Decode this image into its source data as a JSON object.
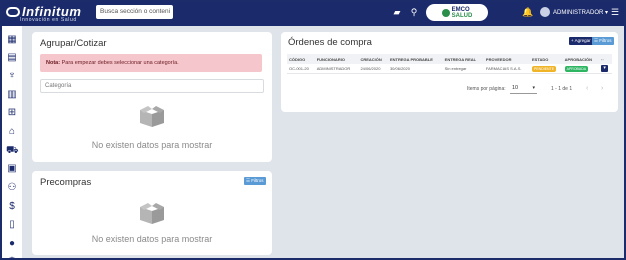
{
  "header": {
    "logo_text": "Infinitum",
    "logo_tagline": "Innovación en Salud",
    "search_placeholder": "Busca sección o conteni",
    "partner_line1": "EMCO",
    "partner_line2": "SALUD",
    "user_label": "ADMINISTRADOR ▾"
  },
  "sidebar": {
    "icons": [
      "dashboard-icon",
      "calendar-icon",
      "stethoscope-icon",
      "hospital-icon",
      "medkit-icon",
      "store-icon",
      "cart-icon",
      "archive-icon",
      "user-search-icon",
      "dollar-icon",
      "book-icon",
      "user-icon",
      "gear-icon"
    ]
  },
  "agrupar": {
    "title": "Agrupar/Cotizar",
    "note_bold": "Nota:",
    "note_text": " Para empezar debes seleccionar una categoría.",
    "category_placeholder": "Categoría",
    "empty_text": "No existen datos para mostrar"
  },
  "precompras": {
    "title": "Precompras",
    "filter_label": "☰ Filtros",
    "empty_text": "No existen datos para mostrar"
  },
  "ordenes": {
    "title": "Órdenes de compra",
    "add_label": "+ Agregar",
    "filter_label": "☰ Filtros",
    "columns": [
      "CÓDIGO",
      "FUNCIONARIO",
      "CREACIÓN",
      "ENTREGA PROBABLE",
      "ENTREGA REAL",
      "PROVEEDOR",
      "ESTADO",
      "APROBACIÓN",
      "··"
    ],
    "rows": [
      {
        "codigo": "OC-001-20",
        "funcionario": "ADMINISTRADOR",
        "creacion": "24/06/2020",
        "entrega_probable": "30/06/2020",
        "entrega_real": "Sin entregar",
        "proveedor": "FARMACIAS S.A.S.",
        "estado": "PENDIENTE",
        "aprobacion": "APROBADA",
        "accion": "▾"
      }
    ],
    "items_per_page_label": "Items por página:",
    "items_per_page_value": "10",
    "range_label": "1 - 1 de 1"
  },
  "colors": {
    "brand_navy": "#1b2a6b",
    "filter_blue": "#5b9bd5",
    "note_bg": "#f5c6cb",
    "pending": "#f0b429",
    "approved": "#2db562"
  }
}
